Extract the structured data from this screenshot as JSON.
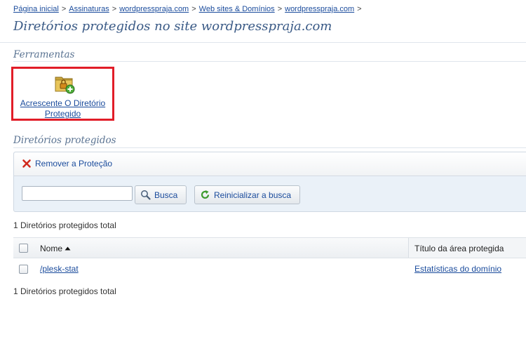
{
  "breadcrumb": {
    "items": [
      "Página inicial",
      "Assinaturas",
      "wordpresspraja.com",
      "Web sites & Domínios",
      "wordpresspraja.com"
    ],
    "separator": ">"
  },
  "page_title": "Diretórios protegidos no site wordpresspraja.com",
  "tools": {
    "section_title": "Ferramentas",
    "add_directory": {
      "label": "Acrescente O Diretório Protegido",
      "icon": "folder-lock-add-icon"
    }
  },
  "directories": {
    "section_title": "Diretórios protegidos",
    "remove_protection_label": "Remover a Proteção",
    "search": {
      "value": "",
      "placeholder": "",
      "search_button": "Busca",
      "reset_button": "Reinicializar a busca"
    },
    "total_text": "1 Diretórios protegidos total",
    "columns": {
      "name": "Nome",
      "title": "Título da área protegida"
    },
    "rows": [
      {
        "name": "/plesk-stat",
        "title": "Estatísticas do domínio"
      }
    ]
  },
  "colors": {
    "link": "#1a4b9c",
    "title": "#3a5a86",
    "highlight_border": "#e11d28",
    "panel_bg": "#eaf1f8"
  }
}
